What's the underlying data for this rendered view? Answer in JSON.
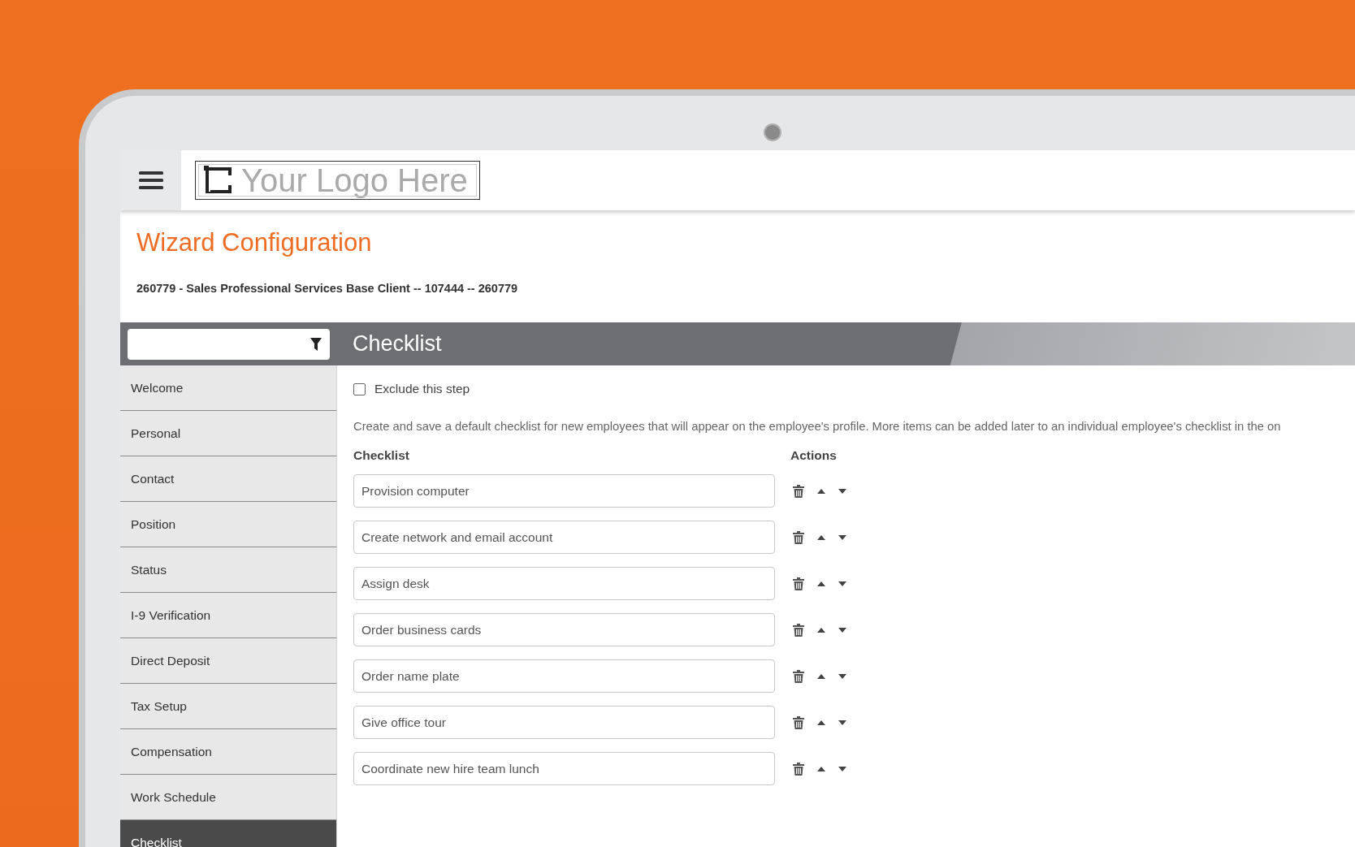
{
  "header": {
    "logo_text": "Your Logo Here"
  },
  "page": {
    "title": "Wizard Configuration",
    "subtitle": "260779 - Sales Professional Services Base Client -- 107444 -- 260779"
  },
  "section_title": "Checklist",
  "sidebar": {
    "items": [
      {
        "label": "Welcome",
        "selected": false
      },
      {
        "label": "Personal",
        "selected": false
      },
      {
        "label": "Contact",
        "selected": false
      },
      {
        "label": "Position",
        "selected": false
      },
      {
        "label": "Status",
        "selected": false
      },
      {
        "label": "I-9 Verification",
        "selected": false
      },
      {
        "label": "Direct Deposit",
        "selected": false
      },
      {
        "label": "Tax Setup",
        "selected": false
      },
      {
        "label": "Compensation",
        "selected": false
      },
      {
        "label": "Work Schedule",
        "selected": false
      },
      {
        "label": "Checklist",
        "selected": true
      }
    ]
  },
  "exclude": {
    "label": "Exclude this step",
    "checked": false
  },
  "description": "Create and save a default checklist for new employees that will appear on the employee's profile. More items can be added later to an individual employee's checklist in the on",
  "columns": [
    "Checklist",
    "Actions"
  ],
  "items": [
    "Provision computer",
    "Create network and email account",
    "Assign desk",
    "Order business cards",
    "Order name plate",
    "Give office tour",
    "Coordinate new hire team lunch"
  ]
}
